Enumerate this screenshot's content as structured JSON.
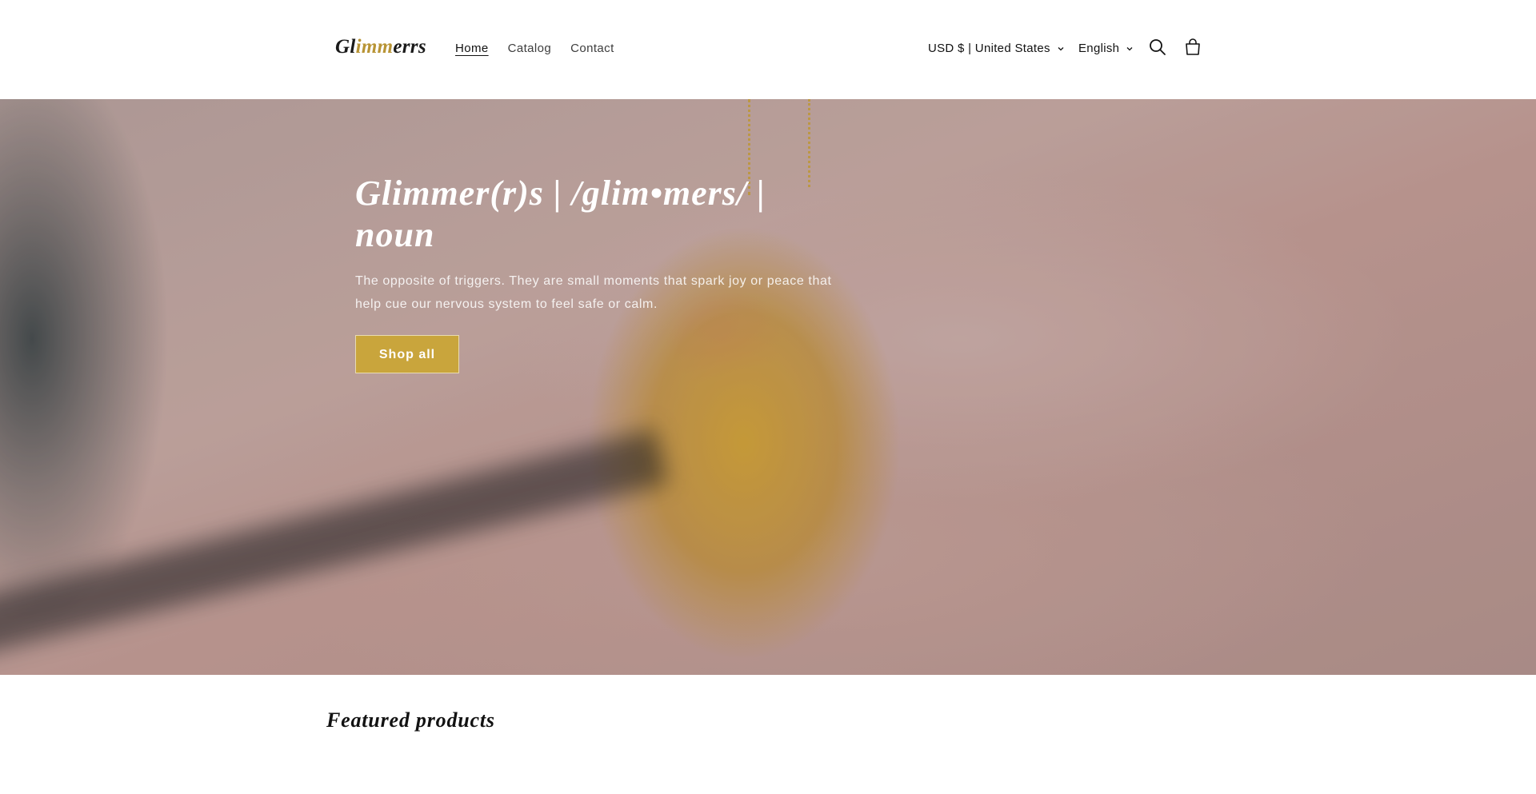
{
  "header": {
    "logo": {
      "prefix": "Gl",
      "accent": "imm",
      "suffix": "errs"
    },
    "nav": [
      {
        "label": "Home",
        "active": true
      },
      {
        "label": "Catalog",
        "active": false
      },
      {
        "label": "Contact",
        "active": false
      }
    ],
    "currency_label": "USD $ | United States",
    "language_label": "English",
    "icons": [
      "search-icon",
      "cart-icon",
      "chevron-down-icon"
    ]
  },
  "hero": {
    "title": "Glimmer(r)s | /glim•mers/ | noun",
    "text": "The opposite of triggers. They are small moments that spark joy or peace that help cue our nervous system to feel safe or calm.",
    "button_label": "Shop all",
    "button_color": "#c9a53c"
  },
  "featured": {
    "title": "Featured products"
  }
}
